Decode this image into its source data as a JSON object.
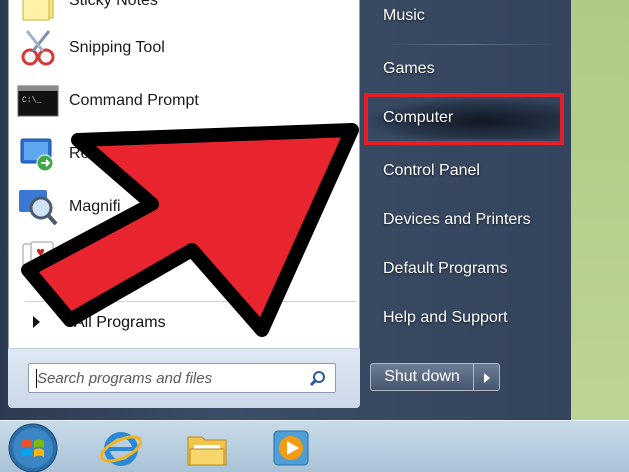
{
  "left_pane": {
    "programs": [
      {
        "label": "Sticky Notes",
        "icon": "sticky-notes-icon"
      },
      {
        "label": "Snipping Tool",
        "icon": "snipping-tool-icon"
      },
      {
        "label": "Command Prompt",
        "icon": "command-prompt-icon"
      },
      {
        "label": "Re",
        "icon": "remote-desktop-icon"
      },
      {
        "label": "Magnifi",
        "icon": "magnifier-icon"
      },
      {
        "label": "",
        "icon": "solitaire-icon"
      }
    ],
    "all_programs": "All Programs",
    "search": {
      "placeholder": "Search programs and files"
    }
  },
  "right_pane": {
    "items": [
      {
        "label": "Music"
      },
      {
        "label": "Games"
      },
      {
        "label": "Computer",
        "highlighted": true
      },
      {
        "label": "Control Panel"
      },
      {
        "label": "Devices and Printers"
      },
      {
        "label": "Default Programs"
      },
      {
        "label": "Help and Support"
      }
    ],
    "shutdown": "Shut down"
  },
  "taskbar": {
    "items": [
      {
        "icon": "windows-start-orb-icon"
      },
      {
        "icon": "internet-explorer-icon"
      },
      {
        "icon": "windows-explorer-icon"
      },
      {
        "icon": "media-player-icon"
      }
    ]
  },
  "colors": {
    "annotation_red": "#e0202a",
    "menu_dark": "#33445c",
    "desktop_green": "#b7d08f"
  }
}
